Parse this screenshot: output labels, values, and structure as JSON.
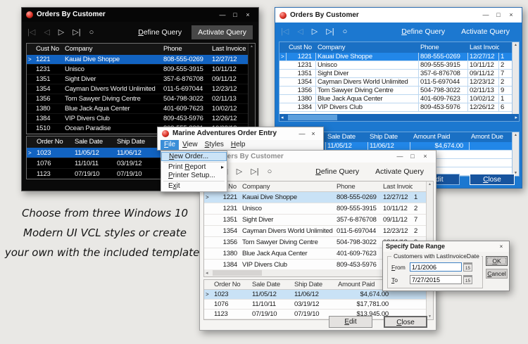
{
  "caption": {
    "lines": [
      "Choose from three Windows 10",
      "Modern UI VCL styles or create",
      "your own with the included templates"
    ]
  },
  "shared": {
    "window_title": "Orders By Customer",
    "nav": {
      "first": "|◁",
      "prior": "◁",
      "next": "▷",
      "last": "▷|",
      "refresh": "○"
    },
    "define_query": "Define Query",
    "activate_query": "Activate Query",
    "edit": "Edit",
    "close": "Close",
    "controls": {
      "minimize": "—",
      "maximize": "□",
      "close": "×"
    }
  },
  "grids": {
    "customers": {
      "columns": [
        "Cust No",
        "Company",
        "Phone",
        "Last Invoice"
      ],
      "rows": [
        [
          "1221",
          "Kauai Dive Shoppe",
          "808-555-0269",
          "12/27/12",
          "1"
        ],
        [
          "1231",
          "Unisco",
          "809-555-3915",
          "10/11/12",
          "2"
        ],
        [
          "1351",
          "Sight Diver",
          "357-6-876708",
          "09/11/12",
          "7"
        ],
        [
          "1354",
          "Cayman Divers World Unlimited",
          "011-5-697044",
          "12/23/12",
          "2"
        ],
        [
          "1356",
          "Tom Sawyer Diving Centre",
          "504-798-3022",
          "02/11/13",
          "9"
        ],
        [
          "1380",
          "Blue Jack Aqua Center",
          "401-609-7623",
          "10/02/12",
          "1"
        ],
        [
          "1384",
          "VIP Divers Club",
          "809-453-5976",
          "12/26/12",
          "6"
        ],
        [
          "1510",
          "Ocean Paradise",
          "808-555-8231",
          "10/03/12",
          ""
        ]
      ]
    },
    "orders": {
      "columns": [
        "Order No",
        "Sale Date",
        "Ship Date",
        "Amount Paid",
        "Amont Due"
      ],
      "rows": [
        [
          "1023",
          "11/05/12",
          "11/06/12",
          "$4,674.00",
          ""
        ],
        [
          "1076",
          "11/10/11",
          "03/19/12",
          "$17,781.00",
          ""
        ],
        [
          "1123",
          "07/19/10",
          "07/19/10",
          "$13,945.00",
          ""
        ]
      ]
    }
  },
  "menu_window": {
    "title": "Marine Adventures Order Entry",
    "menus": [
      "File",
      "View",
      "Styles",
      "Help"
    ],
    "file_menu": {
      "items": [
        "New Order...",
        "Print Report",
        "Printer Setup...",
        "Exit"
      ],
      "submenu_arrow": "▸"
    }
  },
  "dialog": {
    "title": "Specify Date Range",
    "group_label": "Customers with LastInvoiceDate",
    "from_label": "From",
    "from_value": "1/1/2006",
    "to_label": "To",
    "to_value": "7/27/2015",
    "ok_label": "OK",
    "cancel_label": "Cancel",
    "calendar_icon": "15"
  },
  "colors": {
    "accent_blue": "#1c78d0",
    "selection_blue": "#2287e8",
    "dark_bg": "#0a0a0a",
    "light_selection": "#c9e2f6"
  }
}
